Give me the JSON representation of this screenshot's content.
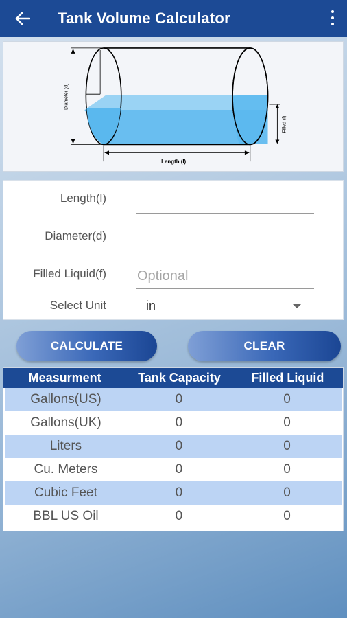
{
  "appbar": {
    "title": "Tank Volume Calculator"
  },
  "diagram": {
    "length_label": "Length (l)",
    "diameter_label": "Diameter (d)",
    "filled_label": "Filled (f)"
  },
  "form": {
    "length": {
      "label": "Length(l)",
      "value": "",
      "placeholder": ""
    },
    "diameter": {
      "label": "Diameter(d)",
      "value": "",
      "placeholder": ""
    },
    "filled": {
      "label": "Filled Liquid(f)",
      "value": "",
      "placeholder": "Optional"
    },
    "unit": {
      "label": "Select Unit",
      "value": "in"
    }
  },
  "buttons": {
    "calculate": "CALCULATE",
    "clear": "CLEAR"
  },
  "results": {
    "headers": [
      "Measurment",
      "Tank Capacity",
      "Filled Liquid"
    ],
    "rows": [
      {
        "name": "Gallons(US)",
        "capacity": "0",
        "filled": "0"
      },
      {
        "name": "Gallons(UK)",
        "capacity": "0",
        "filled": "0"
      },
      {
        "name": "Liters",
        "capacity": "0",
        "filled": "0"
      },
      {
        "name": "Cu. Meters",
        "capacity": "0",
        "filled": "0"
      },
      {
        "name": "Cubic Feet",
        "capacity": "0",
        "filled": "0"
      },
      {
        "name": "BBL US Oil",
        "capacity": "0",
        "filled": "0"
      }
    ]
  },
  "colors": {
    "primary": "#1c4a95",
    "row_highlight": "#bcd4f4",
    "liquid": "#5ab8ee"
  }
}
